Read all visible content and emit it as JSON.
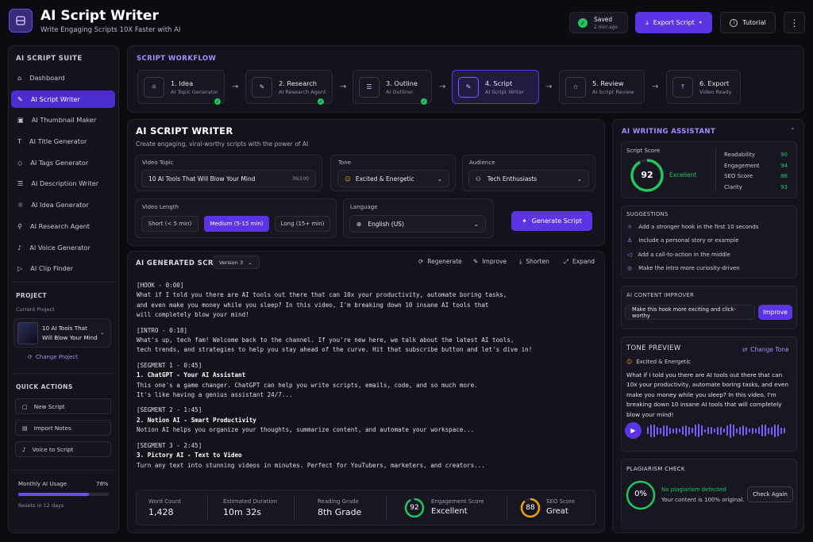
{
  "header": {
    "title": "AI Script Writer",
    "subtitle": "Write Engaging Scripts 10X Faster with AI",
    "saved_label": "Saved",
    "saved_time": "2 min ago",
    "export_label": "Export Script",
    "tutorial_label": "Tutorial"
  },
  "sidebar": {
    "suite_title": "AI SCRIPT SUITE",
    "items": [
      {
        "label": "Dashboard",
        "icon": "home-icon"
      },
      {
        "label": "AI Script Writer",
        "icon": "script-icon",
        "active": true
      },
      {
        "label": "AI Thumbnail Maker",
        "icon": "image-icon"
      },
      {
        "label": "AI Title Generator",
        "icon": "title-icon"
      },
      {
        "label": "AI Tags Generator",
        "icon": "tag-icon"
      },
      {
        "label": "AI Description Writer",
        "icon": "description-icon"
      },
      {
        "label": "AI Idea Generator",
        "icon": "lightbulb-icon"
      },
      {
        "label": "AI Research Agent",
        "icon": "research-icon"
      },
      {
        "label": "AI Voice Generator",
        "icon": "microphone-icon"
      },
      {
        "label": "AI Clip Finder",
        "icon": "clip-icon"
      }
    ],
    "project_title": "PROJECT",
    "current_project_label": "Current Project",
    "project_name": "10 AI Tools That Will Blow Your Mind",
    "project_name_l1": "10 AI Tools That",
    "project_name_l2": "Will Blow Your Mind",
    "change_project": "Change Project",
    "quick_actions_title": "QUICK ACTIONS",
    "quick_actions": [
      "New Script",
      "Import Notes",
      "Voice to Script"
    ],
    "usage_label": "Monthly AI Usage",
    "usage_percent": "78%",
    "usage_fraction": 0.78,
    "usage_reset": "Resets in 12 days"
  },
  "workflow": {
    "title": "SCRIPT WORKFLOW",
    "steps": [
      {
        "title": "1. Idea",
        "sub": "AI Topic Generator",
        "done": true
      },
      {
        "title": "2. Research",
        "sub": "AI Research Agent",
        "done": true
      },
      {
        "title": "3. Outline",
        "sub": "AI Outliner",
        "done": true
      },
      {
        "title": "4. Script",
        "sub": "AI Script Writer",
        "active": true
      },
      {
        "title": "5. Review",
        "sub": "AI Script Review"
      },
      {
        "title": "6. Export",
        "sub": "Video Ready"
      }
    ]
  },
  "writer": {
    "title": "AI SCRIPT WRITER",
    "subtitle": "Create engaging, viral-worthy scripts with the power of AI",
    "video_topic_label": "Video Topic",
    "video_topic_value": "10 AI Tools That Will Blow Your Mind",
    "video_topic_count": "36/100",
    "tone_label": "Tone",
    "tone_value": "Excited & Energetic",
    "audience_label": "Audience",
    "audience_value": "Tech Enthusiasts",
    "length_label": "Video Length",
    "length_options": [
      "Short (< 5 min)",
      "Medium (5-15 min)",
      "Long (15+ min)"
    ],
    "length_selected": 1,
    "language_label": "Language",
    "language_value": "English (US)",
    "generate_label": "Generate Script"
  },
  "generated": {
    "title": "AI GENERATED SCRIPT",
    "version": "Version 3",
    "actions": [
      "Regenerate",
      "Improve",
      "Shorten",
      "Expand"
    ],
    "hook_tag": "[HOOK - 0:00]",
    "hook_l1": "What if I told you there are AI tools out there that can 10x your productivity, automate boring tasks,",
    "hook_l2": "and even make you money while you sleep? In this video, I'm breaking down 10 insane AI tools that",
    "hook_l3": "will completely blow your mind!",
    "intro_tag": "[INTRO - 0:18]",
    "intro_l1": "What's up, tech fam! Welcome back to the channel. If you're new here, we talk about the latest AI tools,",
    "intro_l2": "tech trends, and strategies to help you stay ahead of the curve. Hit that subscribe button and let's dive in!",
    "seg1_tag": "[SEGMENT 1 - 0:45]",
    "seg1_head": "1.  ChatGPT - Your AI Assistant",
    "seg1_l1": "This one's a game changer. ChatGPT can help you write scripts, emails, code, and so much more.",
    "seg1_l2": "It's like having a genius assistant 24/7...",
    "seg2_tag": "[SEGMENT 2 - 1:45]",
    "seg2_head": "2.  Notion AI - Smart Productivity",
    "seg2_l1": "Notion AI helps you organize your thoughts, summarize content, and automate your workspace...",
    "seg3_tag": "[SEGMENT 3 - 2:45]",
    "seg3_head": "3.  Pictory AI - Text to Video",
    "seg3_l1": "Turn any text into stunning videos in minutes. Perfect for YouTubers, marketers, and creators...",
    "stats": {
      "word_count_label": "Word Count",
      "word_count": "1,428",
      "duration_label": "Estimated Duration",
      "duration": "10m 32s",
      "grade_label": "Reading Grade",
      "grade": "8th Grade",
      "engagement_label": "Engagement Score",
      "engagement_value": "92",
      "engagement_text": "Excellent",
      "seo_label": "SEO Score",
      "seo_value": "88",
      "seo_text": "Great"
    }
  },
  "assistant": {
    "title": "AI WRITING ASSISTANT",
    "score_label": "Script Score",
    "score_value": "92",
    "score_text": "Excellent",
    "metrics": [
      {
        "label": "Readability",
        "value": "90"
      },
      {
        "label": "Engagement",
        "value": "94"
      },
      {
        "label": "SEO Score",
        "value": "88"
      },
      {
        "label": "Clarity",
        "value": "93"
      }
    ],
    "suggestions_title": "SUGGESTIONS",
    "suggestions": [
      "Add a stronger hook in the first 10 seconds",
      "Include a personal story or example",
      "Add a call-to-action in the middle",
      "Make the intro more curiosity-driven"
    ],
    "improver_title": "AI CONTENT IMPROVER",
    "improver_input": "Make this hook more exciting and click-worthy",
    "improver_button": "Improve",
    "tone_title": "TONE PREVIEW",
    "change_tone": "Change Tone",
    "tone_value": "Excited & Energetic",
    "tone_l1": "What if I told you there are AI tools out there that can",
    "tone_l2": "10x your productivity, automate boring tasks, and even",
    "tone_l3": "make you money while you sleep? In this video, I'm",
    "tone_l4": "breaking down 10 insane AI tools that will completely",
    "tone_l5": "blow your mind!",
    "plag_title": "PLAGIARISM CHECK",
    "plag_value": "0%",
    "plag_status": "No plagiarism detected",
    "plag_sub": "Your content is 100% original.",
    "plag_button": "Check Again"
  }
}
